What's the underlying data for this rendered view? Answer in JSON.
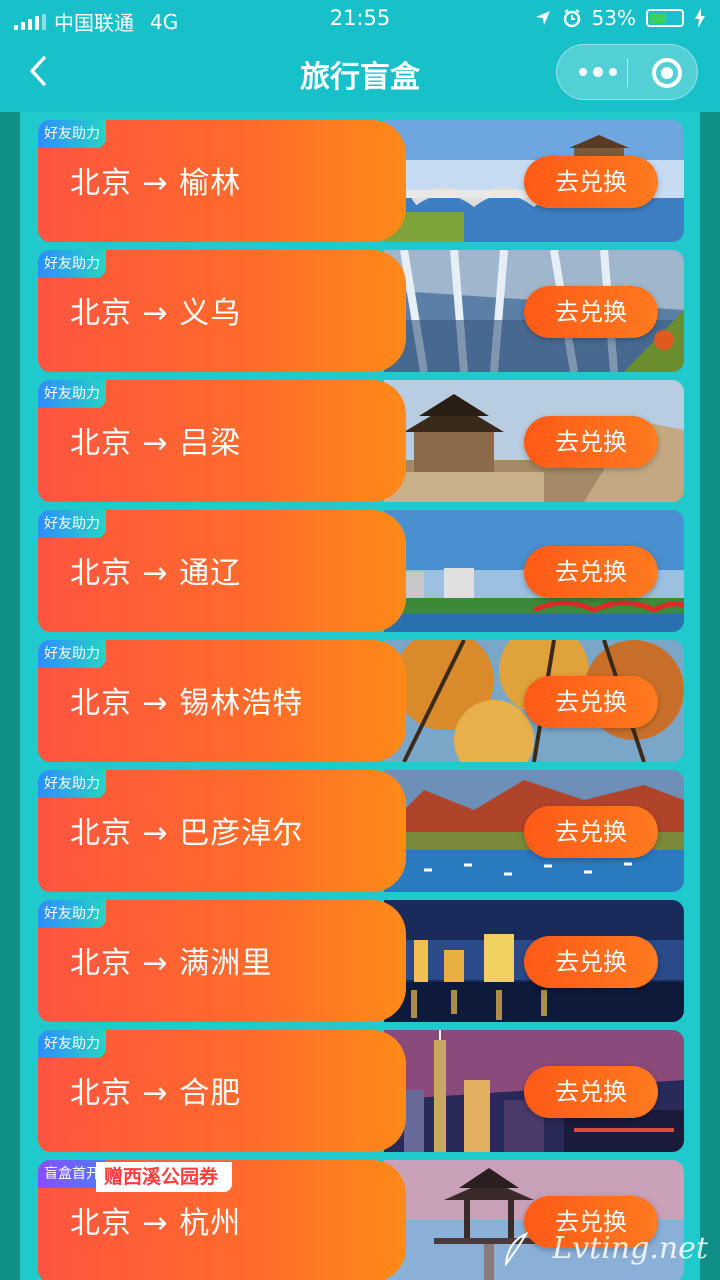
{
  "status_bar": {
    "carrier": "中国联通",
    "network": "4G",
    "time": "21:55",
    "battery_percent": "53%",
    "battery_level": 0.53
  },
  "nav": {
    "title": "旅行盲盒",
    "back_icon": "chevron-left-icon",
    "more_icon": "more-dots-icon",
    "close_icon": "target-icon"
  },
  "cards": [
    {
      "badge": "好友助力",
      "route": "北京 → 榆林",
      "button": "去兑换",
      "photo": "bridge"
    },
    {
      "badge": "好友助力",
      "route": "北京 → 义乌",
      "button": "去兑换",
      "photo": "waterfall"
    },
    {
      "badge": "好友助力",
      "route": "北京 → 吕梁",
      "button": "去兑换",
      "photo": "tower"
    },
    {
      "badge": "好友助力",
      "route": "北京 → 通辽",
      "button": "去兑换",
      "photo": "city-bridge"
    },
    {
      "badge": "好友助力",
      "route": "北京 → 锡林浩特",
      "button": "去兑换",
      "photo": "autumn-trees"
    },
    {
      "badge": "好友助力",
      "route": "北京 → 巴彦淖尔",
      "button": "去兑换",
      "photo": "red-mountains-lake"
    },
    {
      "badge": "好友助力",
      "route": "北京 → 满洲里",
      "button": "去兑换",
      "photo": "night-city"
    },
    {
      "badge": "好友助力",
      "route": "北京 → 合肥",
      "button": "去兑换",
      "photo": "night-tower"
    },
    {
      "badge": "盲盒首开",
      "promo": "赠西溪公园券",
      "route": "北京 → 杭州",
      "button": "去兑换",
      "photo": "pavilion"
    }
  ],
  "watermark": "Lvting.net",
  "colors": {
    "header": "#18c0c9",
    "panel": "#1fc9cc",
    "card_gradient_start": "#ff5440",
    "card_gradient_end": "#ff8a18",
    "button": "#ff6a1c"
  }
}
